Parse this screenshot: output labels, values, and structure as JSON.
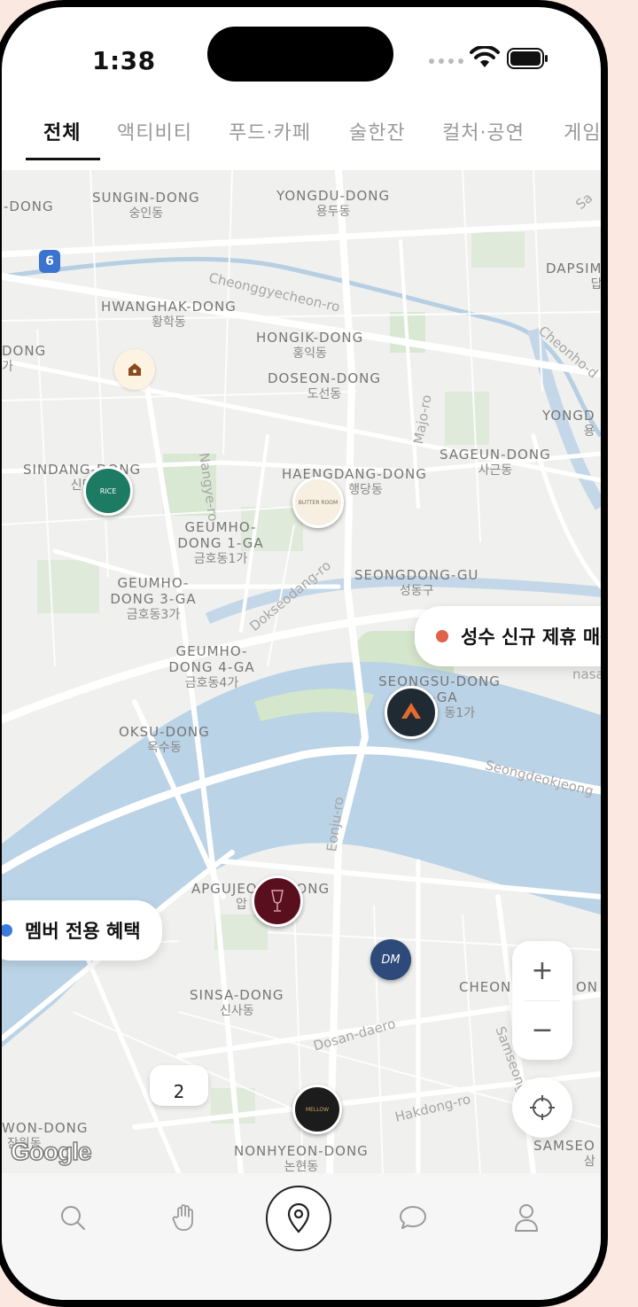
{
  "status_bar": {
    "time": "1:38"
  },
  "tabs": [
    {
      "label": "전체",
      "active": true
    },
    {
      "label": "액티비티"
    },
    {
      "label": "푸드·카페"
    },
    {
      "label": "술한잔"
    },
    {
      "label": "컬처·공연"
    },
    {
      "label": "게임"
    }
  ],
  "map": {
    "areas": [
      {
        "en": "SUNGIN-DONG",
        "ko": "숭인동"
      },
      {
        "en": "YONGDU-DONG",
        "ko": "용두동"
      },
      {
        "en": "-DONG",
        "ko": ""
      },
      {
        "en": "DAPSIM",
        "ko": "답"
      },
      {
        "en": "HWANGHAK-DONG",
        "ko": "황학동"
      },
      {
        "en": "DONG",
        "ko": "가"
      },
      {
        "en": "HONGIK-DONG",
        "ko": "홍익동"
      },
      {
        "en": "DOSEON-DONG",
        "ko": "도선동"
      },
      {
        "en": "YONGD",
        "ko": "용"
      },
      {
        "en": "SINDANG-DONG",
        "ko": "신당"
      },
      {
        "en": "SAGEUN-DONG",
        "ko": "사근동"
      },
      {
        "en": "HAENGDANG-DONG",
        "ko": "행당동"
      },
      {
        "en": "GEUMHO-DONG 1-GA",
        "ko": "금호동1가"
      },
      {
        "en": "GEUMHO-DONG 3-GA",
        "ko": "금호동3가"
      },
      {
        "en": "SEONGDONG-GU",
        "ko": "성동구"
      },
      {
        "en": "GEUMHO-DONG 4-GA",
        "ko": "금호동4가"
      },
      {
        "en": "SEONGSU-DONG 1-GA",
        "ko": "동1가"
      },
      {
        "en": "OKSU-DONG",
        "ko": "옥수동"
      },
      {
        "en": "APGUJEONG-DONG",
        "ko": "압"
      },
      {
        "en": "CHEON",
        "ko": ""
      },
      {
        "en": "ON",
        "ko": ""
      },
      {
        "en": "SINSA-DONG",
        "ko": "신사동"
      },
      {
        "en": "WON-DONG",
        "ko": "잠원동"
      },
      {
        "en": "NONHYEON-DONG",
        "ko": "논현동"
      },
      {
        "en": "SAMSEO",
        "ko": "삼"
      }
    ],
    "roads": [
      {
        "name": "Cheonggyecheon-ro"
      },
      {
        "name": "Cheonho-d"
      },
      {
        "name": "Majo-ro"
      },
      {
        "name": "Nangye-ro"
      },
      {
        "name": "Dokseodang-ro"
      },
      {
        "name": "Seongdeokjeong"
      },
      {
        "name": "Eonju-ro"
      },
      {
        "name": "Dosan-daero"
      },
      {
        "name": "Hakdong-ro"
      },
      {
        "name": "Samseong"
      },
      {
        "name": "nasa"
      },
      {
        "name": "Sa"
      }
    ],
    "highway_shield": "6",
    "pins": [
      {
        "name": "house",
        "color": "#fdf3e2"
      },
      {
        "name": "rice-store",
        "label": "RICE",
        "color": "#1e7b63"
      },
      {
        "name": "butter-room",
        "label": "BUTTER ROOM",
        "color": "#f6efe2"
      },
      {
        "name": "peaks",
        "label": "PEAKS",
        "color": "#1f2a33"
      },
      {
        "name": "wine-bar",
        "color": "#5a0f1e"
      },
      {
        "name": "dm",
        "label": "DM",
        "color": "#2d4a7a"
      },
      {
        "name": "mellow",
        "label": "MELLOW",
        "color": "#1c1c1c"
      }
    ],
    "callouts": [
      {
        "text": "성수 신규 제휴 매장",
        "dot_color": "#e0624a"
      },
      {
        "text": "멤버 전용 혜택",
        "dot_color": "#3a7be0"
      }
    ],
    "cluster_count": "2",
    "zoom_in": "+",
    "zoom_out": "−",
    "attribution": "Google"
  },
  "nav": {
    "items": [
      {
        "icon": "search-icon"
      },
      {
        "icon": "hand-icon"
      },
      {
        "icon": "map-pin-icon",
        "active": true
      },
      {
        "icon": "chat-icon"
      },
      {
        "icon": "profile-icon"
      }
    ]
  }
}
